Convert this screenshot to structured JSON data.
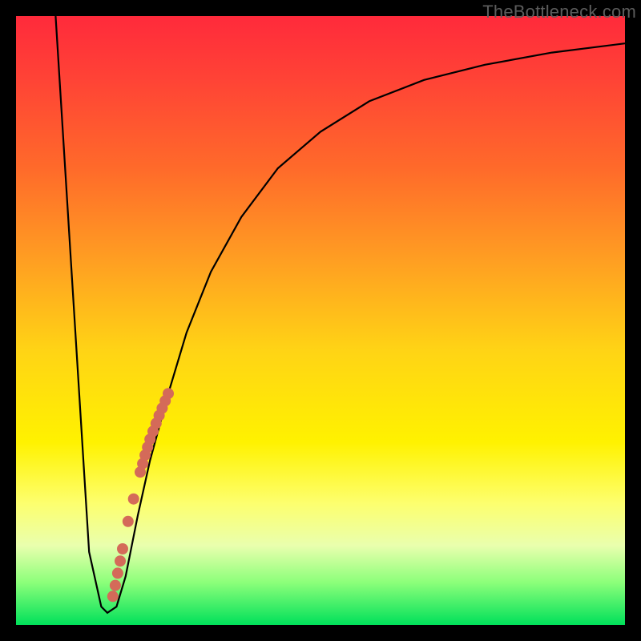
{
  "watermark": "TheBottleneck.com",
  "chart_data": {
    "type": "line",
    "title": "",
    "xlabel": "",
    "ylabel": "",
    "xlim": [
      0,
      100
    ],
    "ylim": [
      0,
      100
    ],
    "grid": false,
    "series": [
      {
        "name": "curve",
        "x": [
          6.5,
          9,
          12,
          14,
          15,
          16.5,
          18,
          20,
          22,
          25,
          28,
          32,
          37,
          43,
          50,
          58,
          67,
          77,
          88,
          100
        ],
        "values": [
          100,
          60,
          12,
          3,
          2,
          3,
          8,
          18,
          27,
          38,
          48,
          58,
          67,
          75,
          81,
          86,
          89.5,
          92,
          94,
          95.5
        ]
      }
    ],
    "markers": [
      {
        "name": "segment-high-end",
        "x": 25.0,
        "y": 38.0
      },
      {
        "name": "segment-high-1",
        "x": 24.5,
        "y": 36.8
      },
      {
        "name": "segment-high-2",
        "x": 24.0,
        "y": 35.6
      },
      {
        "name": "segment-high-3",
        "x": 23.5,
        "y": 34.4
      },
      {
        "name": "segment-high-4",
        "x": 23.0,
        "y": 33.1
      },
      {
        "name": "segment-high-5",
        "x": 22.5,
        "y": 31.8
      },
      {
        "name": "segment-high-6",
        "x": 22.0,
        "y": 30.5
      },
      {
        "name": "segment-high-7",
        "x": 21.6,
        "y": 29.2
      },
      {
        "name": "segment-high-8",
        "x": 21.2,
        "y": 27.9
      },
      {
        "name": "segment-high-9",
        "x": 20.8,
        "y": 26.5
      },
      {
        "name": "segment-high-10",
        "x": 20.4,
        "y": 25.1
      },
      {
        "name": "gap-point-1",
        "x": 19.3,
        "y": 20.7
      },
      {
        "name": "gap-point-2",
        "x": 18.4,
        "y": 17.0
      },
      {
        "name": "segment-low-1",
        "x": 17.5,
        "y": 12.5
      },
      {
        "name": "segment-low-2",
        "x": 17.1,
        "y": 10.5
      },
      {
        "name": "segment-low-3",
        "x": 16.7,
        "y": 8.5
      },
      {
        "name": "segment-low-4",
        "x": 16.3,
        "y": 6.5
      },
      {
        "name": "segment-low-5",
        "x": 15.9,
        "y": 4.7
      }
    ],
    "colors": {
      "curve": "#000000",
      "markers": "#d46a59",
      "background_top": "#ff2a3b",
      "background_bottom": "#00e05a"
    }
  }
}
